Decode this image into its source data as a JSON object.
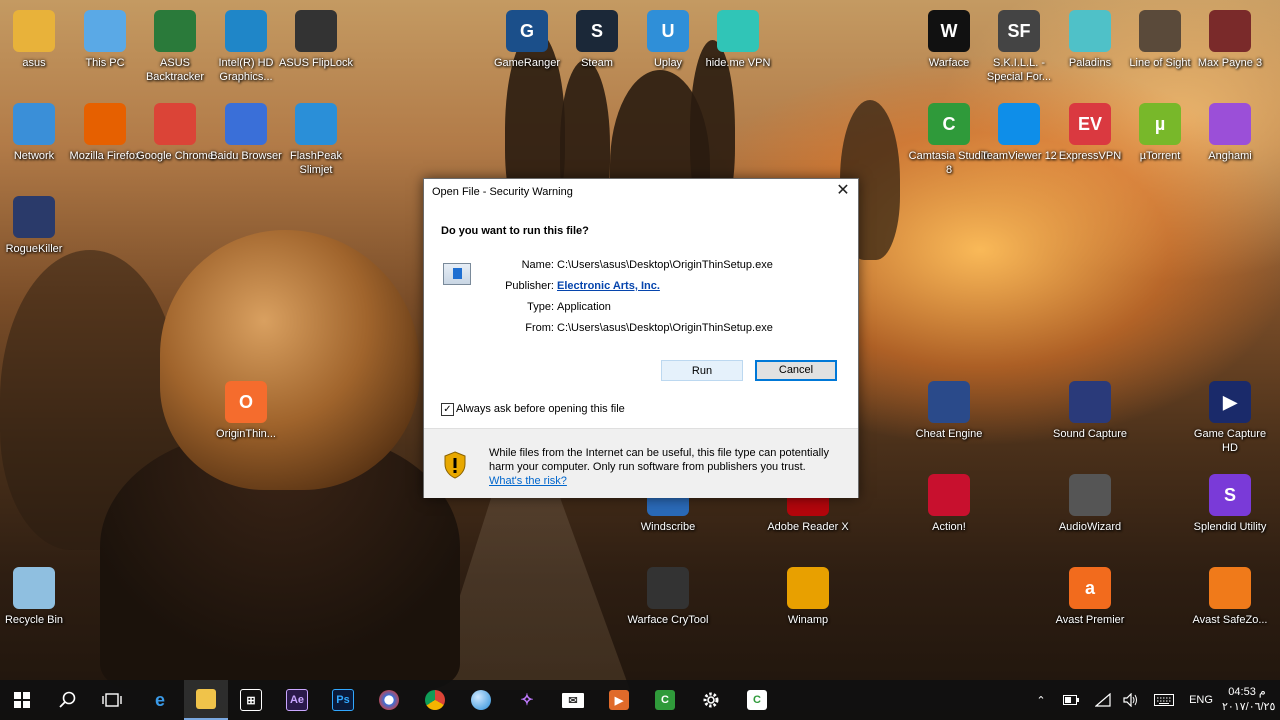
{
  "desktop": {
    "icons": [
      {
        "label": "asus",
        "glyph": "",
        "color": "#e8b23a"
      },
      {
        "label": "This PC",
        "glyph": "",
        "color": "#5aa9e6"
      },
      {
        "label": "ASUS Backtracker",
        "glyph": "",
        "color": "#2a7a3a"
      },
      {
        "label": "Intel(R) HD Graphics...",
        "glyph": "",
        "color": "#1f86c8"
      },
      {
        "label": "ASUS FlipLock",
        "glyph": "",
        "color": "#333333"
      },
      {
        "label": "GameRanger",
        "glyph": "G",
        "color": "#1b4f8a"
      },
      {
        "label": "Steam",
        "glyph": "S",
        "color": "#1b2838"
      },
      {
        "label": "Uplay",
        "glyph": "U",
        "color": "#2f8fd8"
      },
      {
        "label": "hide.me VPN",
        "glyph": "",
        "color": "#30c5b7"
      },
      {
        "label": "Warface",
        "glyph": "W",
        "color": "#111111"
      },
      {
        "label": "S.K.I.L.L. - Special For...",
        "glyph": "SF",
        "color": "#444444"
      },
      {
        "label": "Paladins",
        "glyph": "",
        "color": "#4fc1c8"
      },
      {
        "label": "Line of Sight",
        "glyph": "",
        "color": "#5a4a3a"
      },
      {
        "label": "Max Payne 3",
        "glyph": "",
        "color": "#7a2a2a"
      },
      {
        "label": "Network",
        "glyph": "",
        "color": "#3a8fd8"
      },
      {
        "label": "Mozilla Firefox",
        "glyph": "",
        "color": "#e66000"
      },
      {
        "label": "Google Chrome",
        "glyph": "",
        "color": "#db4437"
      },
      {
        "label": "Baidu Browser",
        "glyph": "",
        "color": "#3a6fd8"
      },
      {
        "label": "FlashPeak Slimjet",
        "glyph": "",
        "color": "#2a8fd8"
      },
      {
        "label": "Camtasia Studio 8",
        "glyph": "C",
        "color": "#2f9a3a"
      },
      {
        "label": "TeamViewer 12",
        "glyph": "",
        "color": "#0e8ee9"
      },
      {
        "label": "ExpressVPN",
        "glyph": "EV",
        "color": "#da3940"
      },
      {
        "label": "µTorrent",
        "glyph": "µ",
        "color": "#78b82a"
      },
      {
        "label": "Anghami",
        "glyph": "",
        "color": "#9b4fd8"
      },
      {
        "label": "RogueKiller",
        "glyph": "",
        "color": "#2a3a6a"
      },
      {
        "label": "OriginThin...",
        "glyph": "O",
        "color": "#f56c2d"
      },
      {
        "label": "Cheat Engine",
        "glyph": "",
        "color": "#2a4a8a"
      },
      {
        "label": "Sound Capture",
        "glyph": "",
        "color": "#2a3a7a"
      },
      {
        "label": "Game Capture HD",
        "glyph": "▶",
        "color": "#1a2a6a"
      },
      {
        "label": "Windscribe",
        "glyph": "",
        "color": "#2a6ab8"
      },
      {
        "label": "Adobe Reader X",
        "glyph": "",
        "color": "#b3060c"
      },
      {
        "label": "Action!",
        "glyph": "",
        "color": "#c8102e"
      },
      {
        "label": "AudioWizard",
        "glyph": "",
        "color": "#555555"
      },
      {
        "label": "Splendid Utility",
        "glyph": "S",
        "color": "#7a3ad8"
      },
      {
        "label": "Recycle Bin",
        "glyph": "",
        "color": "#8fbfe0"
      },
      {
        "label": "Warface CryTool",
        "glyph": "",
        "color": "#333333"
      },
      {
        "label": "Winamp",
        "glyph": "",
        "color": "#e8a000"
      },
      {
        "label": "Avast Premier",
        "glyph": "a",
        "color": "#f26b1d"
      },
      {
        "label": "Avast SafeZo...",
        "glyph": "",
        "color": "#f07a1a"
      }
    ]
  },
  "dialog": {
    "title": "Open File - Security Warning",
    "close": "✕",
    "question": "Do you want to run this file?",
    "name_label": "Name:",
    "name_value": "C:\\Users\\asus\\Desktop\\OriginThinSetup.exe",
    "publisher_label": "Publisher:",
    "publisher_value": "Electronic Arts, Inc.",
    "type_label": "Type:",
    "type_value": "Application",
    "from_label": "From:",
    "from_value": "C:\\Users\\asus\\Desktop\\OriginThinSetup.exe",
    "run_label": "Run",
    "cancel_label": "Cancel",
    "checkbox_label": "Always ask before opening this file",
    "checkbox_checked": true,
    "warning_text": "While files from the Internet can be useful, this file type can potentially harm your computer. Only run software from publishers you trust.",
    "warning_link": "What's the risk?"
  },
  "taskbar": {
    "language": "ENG",
    "time": "04:53 م",
    "date": "٢٠١٧/٠٦/٢٥"
  }
}
